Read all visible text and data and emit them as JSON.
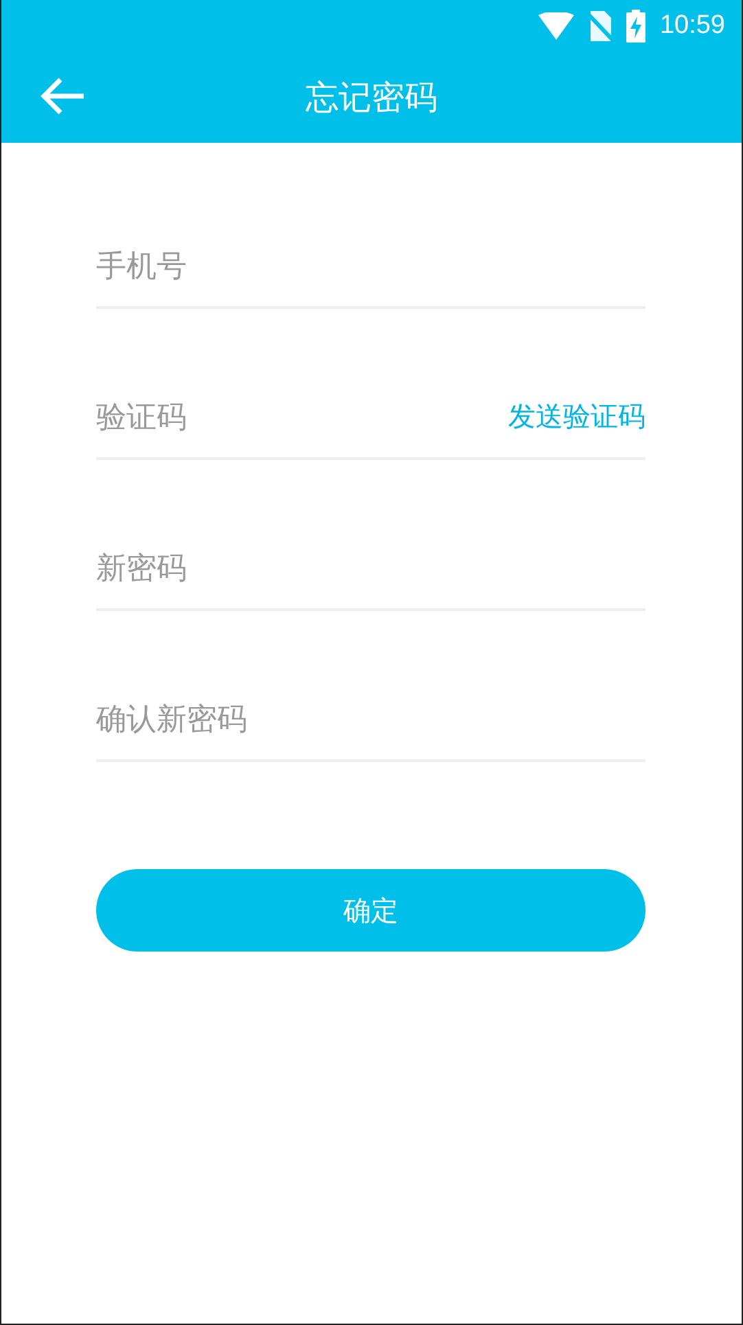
{
  "status_bar": {
    "time": "10:59"
  },
  "header": {
    "title": "忘记密码"
  },
  "fields": [
    {
      "placeholder": "手机号"
    },
    {
      "placeholder": "验证码",
      "action": "发送验证码"
    },
    {
      "placeholder": "新密码"
    },
    {
      "placeholder": "确认新密码"
    }
  ],
  "submit": {
    "label": "确定"
  }
}
